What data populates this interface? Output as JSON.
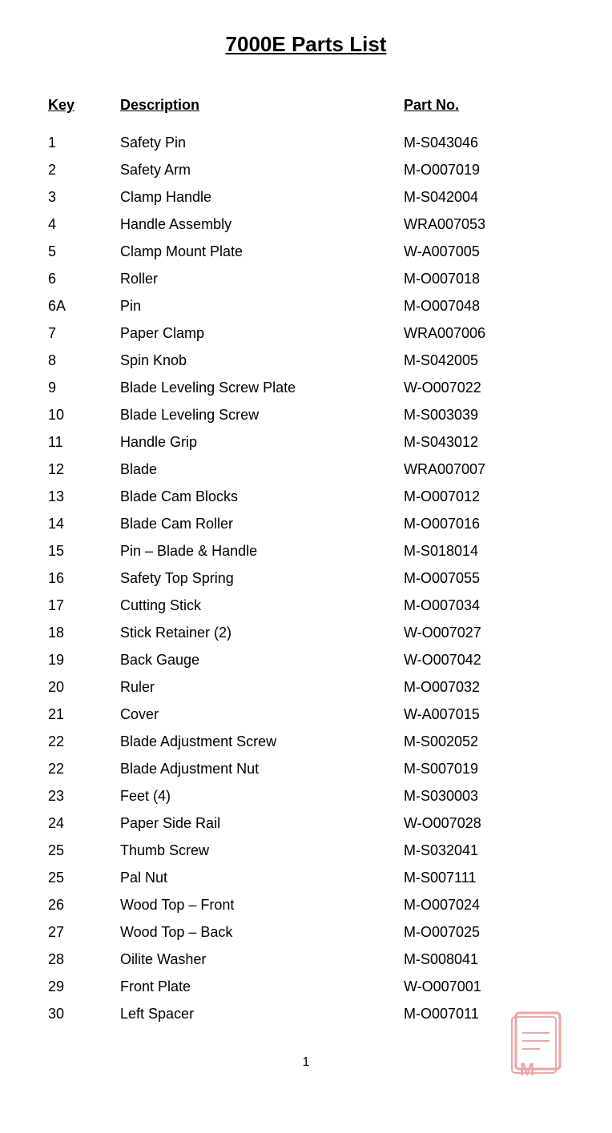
{
  "page": {
    "title": "7000E Parts List",
    "page_number": "1"
  },
  "header": {
    "key_label": "Key",
    "description_label": "Description",
    "partno_label": "Part No."
  },
  "parts": [
    {
      "key": "1",
      "description": "Safety Pin",
      "part_no": "M-S043046"
    },
    {
      "key": "2",
      "description": "Safety Arm",
      "part_no": "M-O007019"
    },
    {
      "key": "3",
      "description": "Clamp Handle",
      "part_no": "M-S042004"
    },
    {
      "key": "4",
      "description": "Handle Assembly",
      "part_no": "WRA007053"
    },
    {
      "key": "5",
      "description": "Clamp Mount Plate",
      "part_no": "W-A007005"
    },
    {
      "key": "6",
      "description": "Roller",
      "part_no": "M-O007018"
    },
    {
      "key": "6A",
      "description": "Pin",
      "part_no": "M-O007048"
    },
    {
      "key": "7",
      "description": "Paper Clamp",
      "part_no": "WRA007006"
    },
    {
      "key": "8",
      "description": "Spin Knob",
      "part_no": "M-S042005"
    },
    {
      "key": "9",
      "description": "Blade Leveling Screw Plate",
      "part_no": "W-O007022"
    },
    {
      "key": "10",
      "description": "Blade Leveling Screw",
      "part_no": "M-S003039"
    },
    {
      "key": "11",
      "description": "Handle Grip",
      "part_no": "M-S043012"
    },
    {
      "key": "12",
      "description": "Blade",
      "part_no": "WRA007007"
    },
    {
      "key": "13",
      "description": "Blade Cam Blocks",
      "part_no": "M-O007012"
    },
    {
      "key": "14",
      "description": "Blade Cam Roller",
      "part_no": "M-O007016"
    },
    {
      "key": "15",
      "description": "Pin – Blade & Handle",
      "part_no": "M-S018014"
    },
    {
      "key": "16",
      "description": "Safety Top Spring",
      "part_no": "M-O007055"
    },
    {
      "key": "17",
      "description": "Cutting Stick",
      "part_no": "M-O007034"
    },
    {
      "key": "18",
      "description": "Stick Retainer (2)",
      "part_no": "W-O007027"
    },
    {
      "key": "19",
      "description": "Back Gauge",
      "part_no": "W-O007042"
    },
    {
      "key": "20",
      "description": "Ruler",
      "part_no": "M-O007032"
    },
    {
      "key": "21",
      "description": "Cover",
      "part_no": "W-A007015"
    },
    {
      "key": "22",
      "description": "Blade Adjustment Screw",
      "part_no": "M-S002052"
    },
    {
      "key": "22",
      "description": "Blade Adjustment Nut",
      "part_no": "M-S007019"
    },
    {
      "key": "23",
      "description": "Feet (4)",
      "part_no": "M-S030003"
    },
    {
      "key": "24",
      "description": "Paper Side Rail",
      "part_no": "W-O007028"
    },
    {
      "key": "25",
      "description": "Thumb Screw",
      "part_no": "M-S032041"
    },
    {
      "key": "25",
      "description": "Pal Nut",
      "part_no": "M-S007111"
    },
    {
      "key": "26",
      "description": "Wood Top – Front",
      "part_no": "M-O007024"
    },
    {
      "key": "27",
      "description": "Wood Top – Back",
      "part_no": "M-O007025"
    },
    {
      "key": "28",
      "description": "Oilite Washer",
      "part_no": "M-S008041"
    },
    {
      "key": "29",
      "description": "Front Plate",
      "part_no": "W-O007001"
    },
    {
      "key": "30",
      "description": "Left Spacer",
      "part_no": "M-O007011"
    }
  ]
}
